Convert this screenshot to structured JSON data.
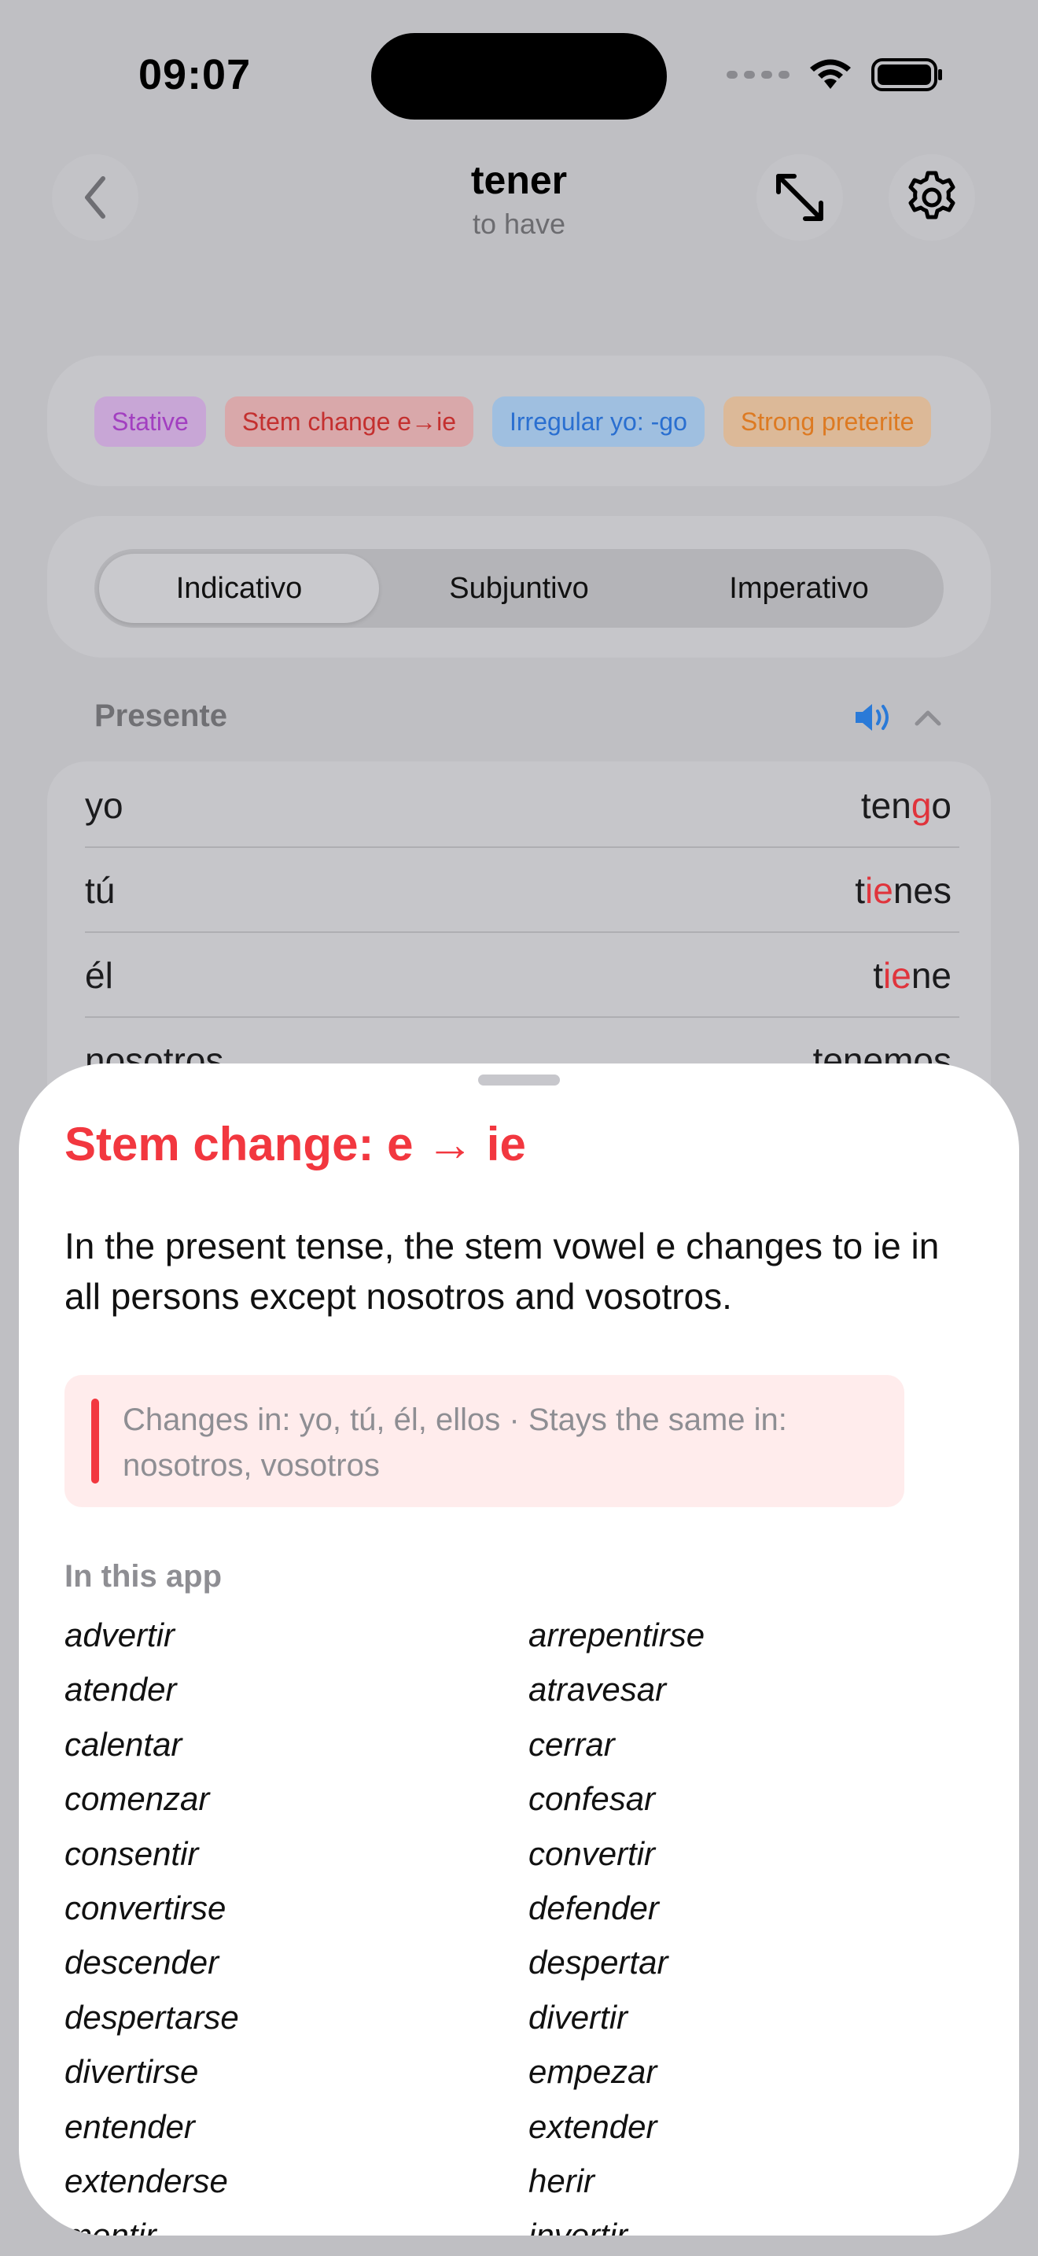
{
  "status": {
    "time": "09:07"
  },
  "nav": {
    "title": "tener",
    "subtitle": "to have",
    "back_icon": "chevron-left-icon",
    "expand_icon": "expand-arrows-icon",
    "settings_icon": "gear-icon"
  },
  "tags": [
    {
      "label": "Stative",
      "bg": "#c8a6d6",
      "fg": "#a23fc0"
    },
    {
      "label": "Stem change e→ie",
      "bg": "#d9a8aa",
      "fg": "#c4302f"
    },
    {
      "label": "Irregular yo: -go",
      "bg": "#9fbfe0",
      "fg": "#2a6fd0"
    },
    {
      "label": "Strong preterite",
      "bg": "#dcb998",
      "fg": "#dd7a22"
    }
  ],
  "moods": {
    "items": [
      "Indicativo",
      "Subjuntivo",
      "Imperativo"
    ],
    "active": "Indicativo"
  },
  "tense": {
    "title": "Presente",
    "rows": [
      {
        "person": "yo",
        "pre": "ten",
        "hl": "g",
        "post": "o"
      },
      {
        "person": "tú",
        "pre": "t",
        "hl": "ie",
        "post": "nes"
      },
      {
        "person": "él",
        "pre": "t",
        "hl": "ie",
        "post": "ne"
      },
      {
        "person": "nosotros",
        "pre": "tenemos",
        "hl": "",
        "post": ""
      }
    ]
  },
  "sheet": {
    "title": "Stem change: e → ie",
    "description": "In the present tense, the stem vowel e changes to ie in all persons except nosotros and vosotros.",
    "note": "Changes in: yo, tú, él, ellos  ·  Stays the same in: nosotros, vosotros",
    "list_heading": "In this app",
    "verbs": [
      "advertir",
      "arrepentirse",
      "atender",
      "atravesar",
      "calentar",
      "cerrar",
      "comenzar",
      "confesar",
      "consentir",
      "convertir",
      "convertirse",
      "defender",
      "descender",
      "despertar",
      "despertarse",
      "divertir",
      "divertirse",
      "empezar",
      "entender",
      "extender",
      "extenderse",
      "herir",
      "mentir",
      "invertir"
    ]
  },
  "colors": {
    "accent_red": "#f2373f",
    "speaker_blue": "#2a7ad8"
  }
}
